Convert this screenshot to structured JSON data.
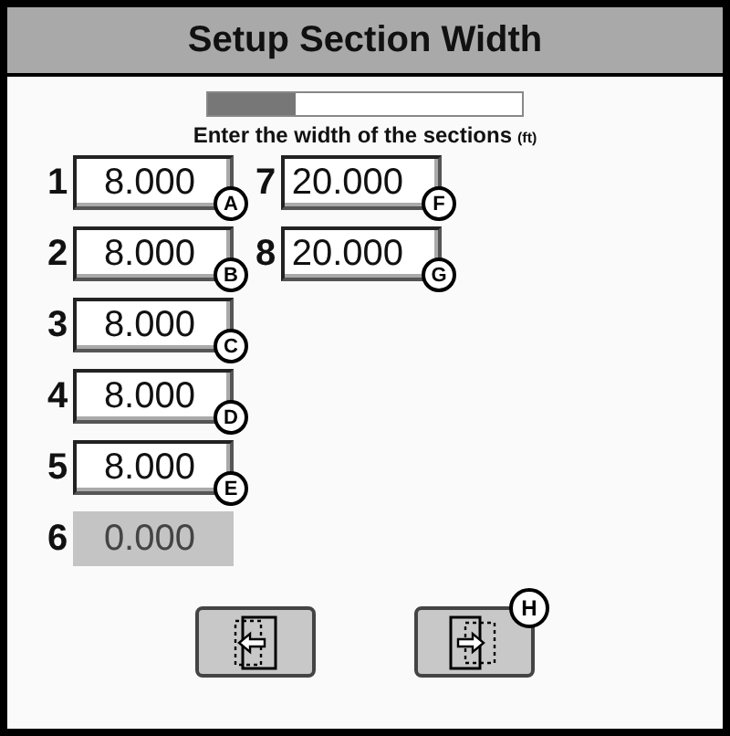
{
  "window": {
    "title": "Setup Section Width"
  },
  "progress": {
    "level": 0.28
  },
  "instruction": {
    "text": "Enter the width of the sections",
    "unit": "(ft)"
  },
  "columns": [
    [
      {
        "number": "1",
        "value": "8.000",
        "callout": "A",
        "disabled": false
      },
      {
        "number": "2",
        "value": "8.000",
        "callout": "B",
        "disabled": false
      },
      {
        "number": "3",
        "value": "8.000",
        "callout": "C",
        "disabled": false
      },
      {
        "number": "4",
        "value": "8.000",
        "callout": "D",
        "disabled": false
      },
      {
        "number": "5",
        "value": "8.000",
        "callout": "E",
        "disabled": false
      },
      {
        "number": "6",
        "value": "0.000",
        "disabled": true
      }
    ],
    [
      {
        "number": "7",
        "value": "20.000",
        "callout": "F",
        "disabled": false
      },
      {
        "number": "8",
        "value": "20.000",
        "callout": "G",
        "disabled": false
      }
    ]
  ],
  "buttons": [
    {
      "kind": "back"
    },
    {
      "kind": "next",
      "callout": "H"
    }
  ]
}
